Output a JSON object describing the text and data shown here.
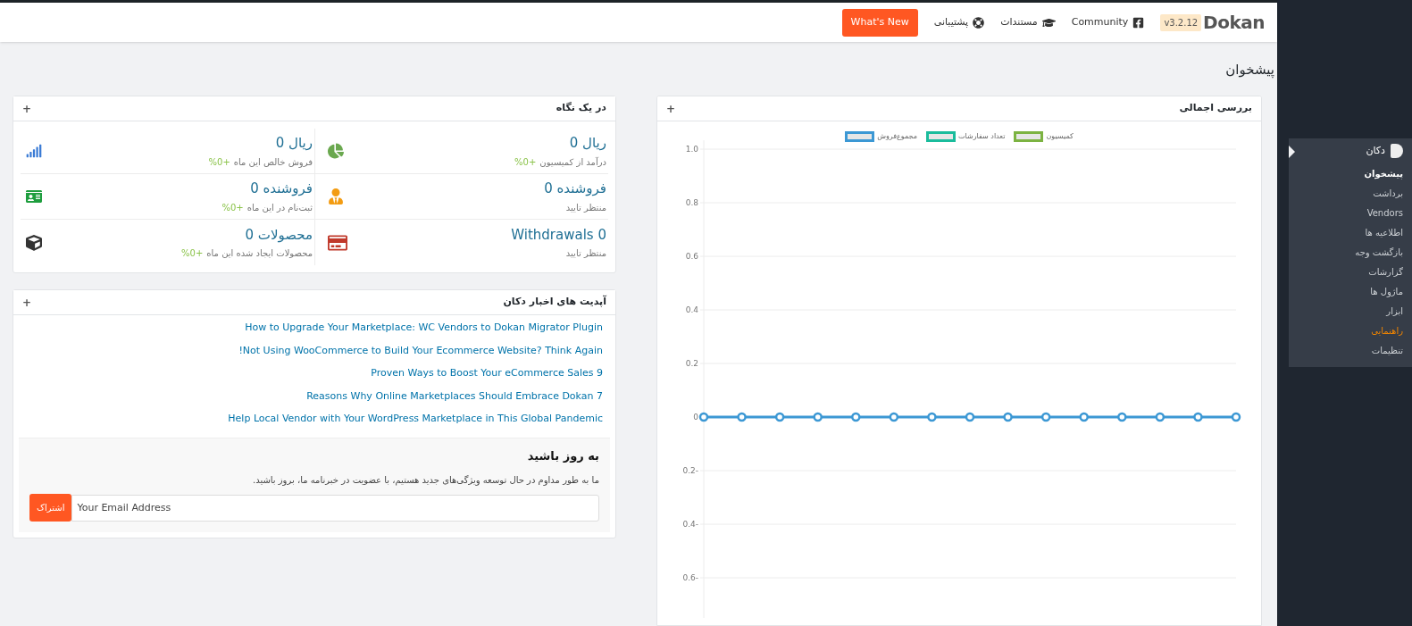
{
  "topbar": {
    "logo": "Dokan",
    "version": "v3.2.12",
    "links": [
      {
        "kind": "facebook",
        "label": "Community"
      },
      {
        "kind": "docs",
        "label": "مستندات"
      },
      {
        "kind": "support",
        "label": "پشتیبانی"
      }
    ],
    "whats_new": "What's New"
  },
  "page_title": "پیشخوان",
  "overview": {
    "title": "بررسی اجمالی",
    "toggle": "+",
    "chart_data": {
      "type": "line",
      "grid": true,
      "series": [
        {
          "name": "کمیسیون",
          "color": "#7cb342",
          "values": [
            null,
            null,
            null,
            null,
            null,
            null,
            null,
            null,
            null,
            null,
            null,
            null,
            null,
            null,
            null
          ]
        },
        {
          "name": "تعداد سفارشات",
          "color": "#1abc9c",
          "values": [
            null,
            null,
            null,
            null,
            null,
            null,
            null,
            null,
            null,
            null,
            null,
            null,
            null,
            null,
            null
          ]
        },
        {
          "name": "مجموع‌فروش",
          "color": "#3c98d4",
          "marker": "circle",
          "values": [
            0,
            0,
            0,
            0,
            0,
            0,
            0,
            0,
            0,
            0,
            0,
            0,
            0,
            0,
            0
          ]
        }
      ],
      "ylim": [
        -0.75,
        1
      ],
      "yticks": [
        {
          "value": 1,
          "label": "1.0"
        },
        0.8,
        0.6,
        0.4,
        0.2,
        0,
        -0.2,
        -0.4,
        -0.6
      ]
    }
  },
  "at_a_glance": {
    "title": "در یک نگاه",
    "toggle": "+",
    "items": [
      {
        "kind": "commission",
        "value": "ریال 0",
        "label": "درآمد از کمیسیون",
        "change": "+0%"
      },
      {
        "kind": "sales",
        "value": "ریال 0",
        "label": "فروش خالص این ماه",
        "change": "+0%"
      },
      {
        "kind": "pending_vendors",
        "value": "فروشنده 0",
        "label": "منتظر تایید"
      },
      {
        "kind": "new_vendors",
        "value": "فروشنده 0",
        "label": "ثبت‌نام در این ماه",
        "change": "+0%"
      },
      {
        "kind": "withdrawals",
        "value": "0 Withdrawals",
        "label": "منتظر تایید"
      },
      {
        "kind": "products",
        "value": "محصولات 0",
        "label": "محصولات ایجاد شده این ماه",
        "change": "+0%"
      }
    ]
  },
  "news": {
    "title": "آپدیت های اخبار دکان",
    "toggle": "+",
    "links": [
      "How to Upgrade Your Marketplace: WC Vendors to Dokan Migrator Plugin",
      "Not Using WooCommerce to Build Your Ecommerce Website? Think Again!",
      "9 Proven Ways to Boost Your eCommerce Sales",
      "7 Reasons Why Online Marketplaces Should Embrace Dokan",
      "Help Local Vendor with Your WordPress Marketplace in This Global Pandemic"
    ],
    "subscribe": {
      "heading": "به روز باشید",
      "text": "ما به طور مداوم در حال توسعه ویژگی‌های جدید هستیم، با عضویت در خبرنامه ما، بروز باشید.",
      "placeholder": "Your Email Address",
      "button": "اشتراک"
    }
  },
  "sidebar": {
    "title": "دکان",
    "items": [
      {
        "label": "پیشخوان",
        "selected": true,
        "highlighted": false
      },
      {
        "label": "برداشت",
        "selected": false,
        "highlighted": false
      },
      {
        "label": "Vendors",
        "selected": false,
        "highlighted": false
      },
      {
        "label": "اطلاعیه ها",
        "selected": false,
        "highlighted": false
      },
      {
        "label": "بازگشت وجه",
        "selected": false,
        "highlighted": false
      },
      {
        "label": "گزارشات",
        "selected": false,
        "highlighted": false
      },
      {
        "label": "ماژول ها",
        "selected": false,
        "highlighted": false
      },
      {
        "label": "ابزار",
        "selected": false,
        "highlighted": false
      },
      {
        "label": "راهنمایی",
        "selected": false,
        "highlighted": true
      },
      {
        "label": "تنظیمات",
        "selected": false,
        "highlighted": false
      }
    ]
  }
}
